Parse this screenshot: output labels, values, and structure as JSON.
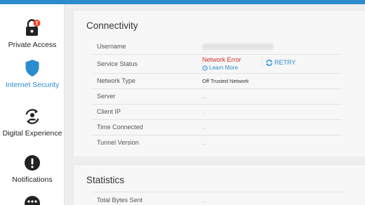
{
  "sidebar": {
    "items": [
      {
        "label": "Private Access",
        "icon": "lock-alert-icon"
      },
      {
        "label": "Internet Security",
        "icon": "shield-icon"
      },
      {
        "label": "Digital Experience",
        "icon": "user-refresh-icon"
      },
      {
        "label": "Notifications",
        "icon": "exclamation-icon"
      },
      {
        "label": "",
        "icon": "more-icon"
      }
    ],
    "active_index": 1
  },
  "connectivity": {
    "title": "Connectivity",
    "rows": {
      "username": {
        "label": "Username"
      },
      "service_status": {
        "label": "Service Status",
        "value": "Network Error",
        "learn_more": "Learn More",
        "retry": "RETRY"
      },
      "network_type": {
        "label": "Network Type",
        "value": "Off Trusted Network"
      },
      "server": {
        "label": "Server",
        "value": "..."
      },
      "client_ip": {
        "label": "Client IP",
        "value": "..."
      },
      "time_connected": {
        "label": "Time Connected",
        "value": "..."
      },
      "tunnel_version": {
        "label": "Tunnel Version",
        "value": "..."
      }
    }
  },
  "statistics": {
    "title": "Statistics",
    "rows": {
      "total_bytes_sent": {
        "label": "Total Bytes Sent",
        "value": "..."
      }
    }
  },
  "colors": {
    "accent": "#2b8ccd",
    "error": "#d0302f",
    "alert_badge": "#e8472f"
  }
}
